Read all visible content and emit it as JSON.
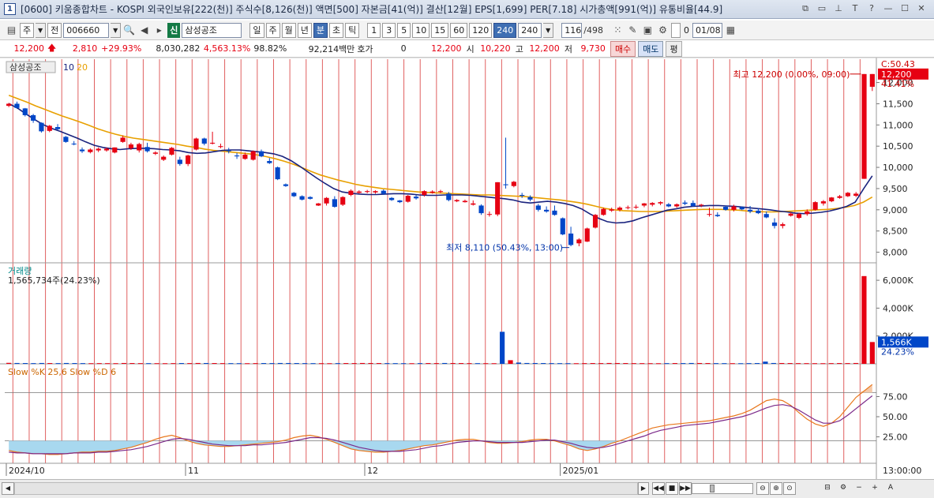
{
  "window": {
    "app_icon": "1",
    "title": "[0600] 키움종합차트 - KOSPI 외국인보유[222(천)] 주식수[8,126(천)] 액면[500] 자본금[41(억)] 결산[12월] EPS[1,699] PER[7.18] 시가총액[991(억)] 유통비율[44.9]",
    "buttons": [
      "⧉",
      "▭",
      "⊥",
      "T",
      "?",
      "—",
      "☐",
      "✕"
    ]
  },
  "toolbar": {
    "period_select": "주",
    "jeon_button": "전",
    "stock_code": "006660",
    "market_badge": "신",
    "stock_name": "삼성공조",
    "period_buttons": [
      "일",
      "주",
      "월",
      "년",
      "분",
      "초",
      "틱"
    ],
    "active_period": "분",
    "interval_buttons": [
      "1",
      "3",
      "5",
      "10",
      "15",
      "60",
      "120",
      "240"
    ],
    "active_interval": "240",
    "interval_value": "240",
    "count_value": "116",
    "count_total": "/498",
    "checkbox_value": "0",
    "date_value": "01/08"
  },
  "pricebar": {
    "price": "12,200",
    "change": "2,810",
    "change_pct": "+29.93%",
    "volume": "8,030,282",
    "volume_ratio": "4,563.13%",
    "ratio2": "98.82%",
    "trade_value": "92,214백만",
    "hoga_label": "호가",
    "hoga_value": "0",
    "hoga_price": "12,200",
    "open_label": "시",
    "open": "10,220",
    "high_label": "고",
    "high": "12,200",
    "low_label": "저",
    "low": "9,730",
    "buy_label": "매수",
    "sell_label": "매도",
    "flat_label": "평"
  },
  "chart_data": {
    "type": "candlestick",
    "legend": {
      "name": "삼성공조",
      "ma1": "10",
      "ma2": "20"
    },
    "y_ticks": [
      8000,
      8500,
      9000,
      9500,
      10000,
      10500,
      11000,
      11500,
      12000
    ],
    "y_tick_labels": [
      "8,000",
      "8,500",
      "9,000",
      "9,500",
      "10,000",
      "10,500",
      "11,000",
      "11,500",
      "12,000"
    ],
    "ylim": [
      7750,
      12550
    ],
    "price_box": "12,200",
    "price_box_sub": "41.41%",
    "top_label": "C:50.43",
    "annotation_high": "최고 12,200 (0.00%, 09:00)",
    "annotation_low": "최저 8,110 (50.43%, 13:00)",
    "x_labels": [
      {
        "label": "2024/10",
        "index": 0
      },
      {
        "label": "11",
        "index": 22
      },
      {
        "label": "12",
        "index": 44
      },
      {
        "label": "2025/01",
        "index": 68
      }
    ],
    "time_label": "13:00:00",
    "candles": [
      [
        11450,
        11520,
        11420,
        11500
      ],
      [
        11500,
        11550,
        11380,
        11400
      ],
      [
        11390,
        11400,
        11200,
        11230
      ],
      [
        11230,
        11260,
        11050,
        11100
      ],
      [
        11050,
        11060,
        10820,
        10850
      ],
      [
        10860,
        11000,
        10830,
        10980
      ],
      [
        10950,
        11020,
        10880,
        10900
      ],
      [
        10720,
        10740,
        10580,
        10600
      ],
      [
        10560,
        10620,
        10520,
        10550
      ],
      [
        10420,
        10470,
        10340,
        10380
      ],
      [
        10360,
        10450,
        10330,
        10420
      ],
      [
        10400,
        10470,
        10360,
        10440
      ],
      [
        10400,
        10470,
        10370,
        10440
      ],
      [
        10350,
        10470,
        10330,
        10470
      ],
      [
        10600,
        10750,
        10580,
        10700
      ],
      [
        10450,
        10580,
        10410,
        10540
      ],
      [
        10400,
        10580,
        10350,
        10550
      ],
      [
        10480,
        10580,
        10350,
        10380
      ],
      [
        10320,
        10380,
        10290,
        10350
      ],
      [
        10180,
        10280,
        10150,
        10250
      ],
      [
        10300,
        10480,
        10280,
        10460
      ],
      [
        10180,
        10250,
        10040,
        10080
      ],
      [
        10080,
        10300,
        10030,
        10280
      ],
      [
        10420,
        10700,
        10400,
        10680
      ],
      [
        10680,
        10700,
        10520,
        10560
      ],
      [
        10560,
        10840,
        10540,
        10580
      ],
      [
        10480,
        10560,
        10450,
        10500
      ],
      [
        10400,
        10460,
        10330,
        10380
      ],
      [
        10280,
        10340,
        10200,
        10260
      ],
      [
        10200,
        10350,
        10180,
        10300
      ],
      [
        10180,
        10400,
        10160,
        10380
      ],
      [
        10380,
        10420,
        10240,
        10260
      ],
      [
        10150,
        10220,
        10080,
        10100
      ],
      [
        10000,
        10020,
        9700,
        9720
      ],
      [
        9600,
        9620,
        9540,
        9560
      ],
      [
        9400,
        9420,
        9300,
        9320
      ],
      [
        9320,
        9340,
        9220,
        9240
      ],
      [
        9300,
        9320,
        9240,
        9260
      ],
      [
        9100,
        9160,
        9090,
        9150
      ],
      [
        9150,
        9300,
        9100,
        9280
      ],
      [
        9250,
        9320,
        9050,
        9070
      ],
      [
        9120,
        9320,
        9090,
        9300
      ],
      [
        9350,
        9480,
        9320,
        9450
      ],
      [
        9400,
        9460,
        9380,
        9430
      ]
    ],
    "candles_b": [
      [
        9420,
        9470,
        9390,
        9440
      ],
      [
        9410,
        9460,
        9380,
        9440
      ],
      [
        9450,
        9480,
        9350,
        9380
      ],
      [
        9280,
        9300,
        9210,
        9230
      ],
      [
        9220,
        9230,
        9160,
        9180
      ],
      [
        9190,
        9350,
        9170,
        9330
      ],
      [
        9310,
        9350,
        9240,
        9270
      ],
      [
        9350,
        9460,
        9310,
        9440
      ],
      [
        9400,
        9460,
        9380,
        9430
      ],
      [
        9420,
        9470,
        9390,
        9440
      ],
      [
        9380,
        9420,
        9200,
        9230
      ],
      [
        9200,
        9250,
        9180,
        9230
      ],
      [
        9180,
        9240,
        9170,
        9210
      ],
      [
        9120,
        9220,
        9100,
        9150
      ],
      [
        9100,
        9130,
        8880,
        8920
      ],
      [
        8900,
        8960,
        8840,
        8900
      ],
      [
        8890,
        9650,
        8850,
        9650
      ],
      [
        9600,
        10700,
        9500,
        9580
      ],
      [
        9560,
        9680,
        9530,
        9660
      ],
      [
        9350,
        9400,
        9280,
        9330
      ],
      [
        9300,
        9340,
        9200,
        9240
      ],
      [
        9100,
        9140,
        8960,
        9000
      ],
      [
        9000,
        9080,
        8930,
        8960
      ],
      [
        8980,
        9100,
        8860,
        8880
      ],
      [
        8800,
        8820,
        8400,
        8420
      ],
      [
        8440,
        8600,
        8140,
        8170
      ],
      [
        8210,
        8330,
        8140,
        8300
      ],
      [
        8250,
        8580,
        8240,
        8560
      ],
      [
        8580,
        8900,
        8560,
        8880
      ],
      [
        8880,
        9050,
        8860,
        9020
      ],
      [
        8980,
        9050,
        8950,
        9010
      ],
      [
        9000,
        9080,
        8960,
        9050
      ],
      [
        9040,
        9100,
        9010,
        9060
      ],
      [
        9060,
        9120,
        9020,
        9070
      ],
      [
        9100,
        9160,
        9060,
        9150
      ],
      [
        9120,
        9180,
        9080,
        9160
      ],
      [
        9150,
        9200,
        9110,
        9180
      ],
      [
        9130,
        9160,
        9060,
        9080
      ],
      [
        9080,
        9150,
        9050,
        9130
      ],
      [
        9170,
        9220,
        9110,
        9140
      ],
      [
        9160,
        9220,
        9070,
        9090
      ],
      [
        9100,
        9140,
        9060,
        9120
      ],
      [
        8900,
        9050,
        8840,
        8900
      ],
      [
        8880,
        8940,
        8830,
        8850
      ],
      [
        9070,
        9100,
        8980,
        9000
      ],
      [
        9000,
        9120,
        8960,
        9080
      ],
      [
        9060,
        9080,
        8990,
        9010
      ],
      [
        9000,
        9090,
        8920,
        8960
      ],
      [
        8980,
        9040,
        8900,
        8920
      ],
      [
        8900,
        8960,
        8800,
        8820
      ],
      [
        8700,
        8800,
        8560,
        8620
      ],
      [
        8620,
        8700,
        8560,
        8660
      ],
      [
        8860,
        8940,
        8840,
        8910
      ],
      [
        8810,
        8930,
        8780,
        8900
      ],
      [
        8900,
        9010,
        8860,
        8960
      ],
      [
        9000,
        9200,
        8980,
        9180
      ],
      [
        9150,
        9230,
        9100,
        9200
      ],
      [
        9200,
        9300,
        9180,
        9290
      ],
      [
        9280,
        9350,
        9260,
        9320
      ],
      [
        9320,
        9420,
        9300,
        9400
      ],
      [
        9330,
        9420,
        9300,
        9380
      ],
      [
        9730,
        12200,
        9730,
        12200
      ],
      [
        11900,
        12200,
        11800,
        12200
      ]
    ],
    "ma10": [
      11500,
      11400,
      11260,
      11130,
      11010,
      10920,
      10850,
      10770,
      10690,
      10600,
      10520,
      10470,
      10440,
      10420,
      10440,
      10450,
      10450,
      10440,
      10420,
      10410,
      10390,
      10350,
      10330,
      10340,
      10370,
      10400,
      10410,
      10410,
      10390,
      10370,
      10350,
      10320,
      10260,
      10160,
      10030,
      9890,
      9750,
      9620,
      9500,
      9420,
      9390,
      9370,
      9360,
      9360,
      9370,
      9380,
      9380,
      9370,
      9350,
      9340,
      9340,
      9350,
      9350,
      9350,
      9340,
      9320,
      9300,
      9280,
      9260,
      9230,
      9180,
      9160,
      9180,
      9200,
      9180,
      9150,
      9100,
      9020,
      8900,
      8800,
      8720,
      8690,
      8700,
      8740,
      8810,
      8870,
      8930,
      8990,
      9020,
      9060,
      9080,
      9090,
      9100,
      9100,
      9090,
      9080,
      9060,
      9040,
      9020,
      9000,
      8970,
      8950,
      8920,
      8910,
      8920,
      8940,
      8970,
      9020,
      9080,
      9180,
      9500,
      9800
    ],
    "ma20": [
      11700,
      11620,
      11540,
      11450,
      11370,
      11290,
      11210,
      11140,
      11070,
      10990,
      10910,
      10840,
      10780,
      10730,
      10690,
      10660,
      10630,
      10600,
      10570,
      10540,
      10500,
      10470,
      10430,
      10400,
      10380,
      10360,
      10340,
      10320,
      10290,
      10250,
      10200,
      10140,
      10070,
      9990,
      9900,
      9820,
      9760,
      9700,
      9650,
      9600,
      9560,
      9530,
      9500,
      9480,
      9460,
      9440,
      9420,
      9410,
      9400,
      9390,
      9380,
      9370,
      9360,
      9350,
      9350,
      9340,
      9330,
      9320,
      9310,
      9290,
      9270,
      9250,
      9230,
      9200,
      9170,
      9130,
      9080,
      9030,
      9000,
      8980,
      8970,
      8960,
      8960,
      8960,
      8970,
      8980,
      8990,
      9000,
      9010,
      9010,
      9010,
      9000,
      8990,
      8970,
      8960,
      8950,
      8950,
      8960,
      8970,
      8980,
      8990,
      9000,
      9010,
      9030,
      9060,
      9100,
      9180,
      9300
    ],
    "volume": {
      "label": "거래량",
      "value_label": "1,565,734주(24.23%)",
      "y_ticks": [
        2000,
        4000,
        6000
      ],
      "y_tick_labels": [
        "2,000K",
        "4,000K",
        "6,000K"
      ],
      "ylim": [
        0,
        6800
      ],
      "box": "1,566K",
      "box_sub": "24.23%",
      "bars": [
        70,
        60,
        55,
        50,
        60,
        55,
        50,
        60,
        55,
        50,
        45,
        50,
        48,
        46,
        60,
        55,
        50,
        48,
        46,
        44,
        50,
        55,
        52,
        60,
        58,
        55,
        50,
        48,
        46,
        44,
        50,
        55,
        52,
        60,
        58,
        55,
        50,
        48,
        46,
        44,
        50,
        55,
        52,
        60,
        58,
        55,
        50,
        48,
        46,
        44,
        50,
        55,
        52,
        60,
        58,
        55,
        50,
        48,
        46,
        44,
        2300,
        260,
        90,
        60,
        58,
        55,
        50,
        48,
        46,
        44,
        50,
        55,
        52,
        60,
        58,
        55,
        50,
        48,
        46,
        44,
        50,
        55,
        52,
        60,
        58,
        55,
        50,
        48,
        46,
        44,
        50,
        55,
        160,
        60,
        58,
        55,
        50,
        48,
        46,
        44,
        50,
        55,
        52,
        60,
        6300,
        1566
      ],
      "bar_colors": "rule"
    },
    "stochastic": {
      "label": "Slow %K 25,6  Slow %D 6",
      "y_ticks": [
        25,
        50,
        75
      ],
      "y_tick_labels": [
        "25.00",
        "50.00",
        "75.00"
      ],
      "ylim": [
        0,
        100
      ],
      "upper": 80,
      "lower": 20,
      "k": [
        8,
        6,
        5,
        4,
        4,
        3,
        3,
        4,
        5,
        6,
        6,
        7,
        7,
        8,
        10,
        12,
        15,
        18,
        22,
        25,
        27,
        24,
        20,
        17,
        15,
        14,
        13,
        13,
        14,
        15,
        16,
        17,
        18,
        19,
        21,
        24,
        26,
        27,
        25,
        22,
        18,
        14,
        10,
        8,
        7,
        6,
        6,
        7,
        8,
        10,
        12,
        14,
        15,
        17,
        19,
        21,
        22,
        22,
        20,
        18,
        17,
        17,
        18,
        19,
        21,
        22,
        22,
        20,
        17,
        14,
        10,
        8,
        10,
        13,
        17,
        20,
        24,
        28,
        32,
        36,
        38,
        40,
        41,
        42,
        43,
        44,
        45,
        47,
        49,
        51,
        54,
        58,
        64,
        70,
        72,
        70,
        64,
        55,
        47,
        41,
        38,
        42,
        50,
        62,
        74,
        82,
        90
      ],
      "d": [
        6,
        5,
        5,
        4,
        4,
        4,
        4,
        4,
        5,
        5,
        5,
        6,
        6,
        7,
        8,
        9,
        11,
        13,
        16,
        19,
        22,
        23,
        22,
        20,
        18,
        16,
        15,
        14,
        14,
        14,
        15,
        15,
        16,
        17,
        18,
        20,
        22,
        24,
        24,
        23,
        21,
        18,
        15,
        12,
        10,
        8,
        7,
        7,
        7,
        8,
        9,
        11,
        13,
        14,
        16,
        18,
        19,
        20,
        20,
        19,
        18,
        18,
        18,
        18,
        19,
        20,
        21,
        21,
        19,
        17,
        14,
        12,
        11,
        12,
        14,
        17,
        20,
        23,
        26,
        30,
        33,
        35,
        37,
        39,
        40,
        41,
        42,
        44,
        46,
        48,
        50,
        53,
        57,
        61,
        64,
        65,
        63,
        58,
        52,
        46,
        42,
        42,
        45,
        52,
        60,
        68,
        76
      ]
    }
  }
}
